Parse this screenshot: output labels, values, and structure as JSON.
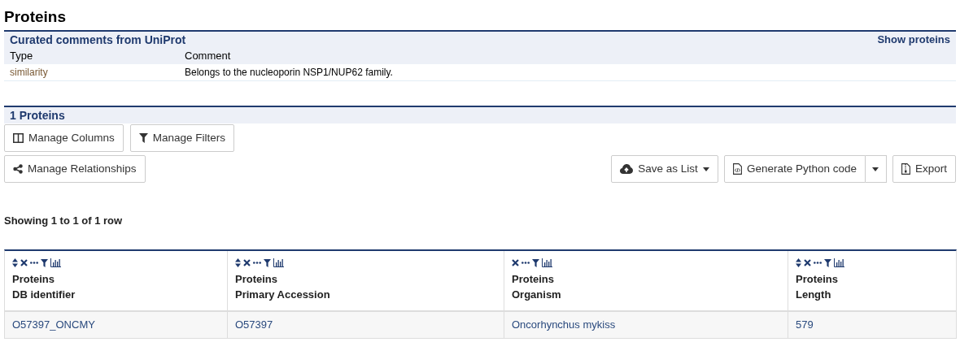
{
  "title": "Proteins",
  "comments": {
    "heading": "Curated comments from UniProt",
    "link": "Show proteins",
    "columns": [
      "Type",
      "Comment"
    ],
    "rows": [
      {
        "type": "similarity",
        "comment": "Belongs to the nucleoporin NSP1/NUP62 family."
      }
    ]
  },
  "results": {
    "heading": "1 Proteins",
    "left_buttons": [
      [
        {
          "kind": "columns",
          "label": "Manage Columns"
        },
        {
          "kind": "filter",
          "label": "Manage Filters"
        }
      ],
      [
        {
          "kind": "share",
          "label": "Manage Relationships"
        }
      ]
    ],
    "right_buttons": [
      {
        "kind": "cloud",
        "label": "Save as List",
        "caret": true,
        "split": false
      },
      {
        "kind": "code",
        "label": "Generate Python code",
        "caret": false,
        "split": true
      },
      {
        "kind": "export",
        "label": "Export",
        "caret": false,
        "split": false
      }
    ],
    "showing": "Showing 1 to 1 of 1 row",
    "table": {
      "columns": [
        {
          "lines": [
            "Proteins",
            "DB identifier"
          ],
          "sortable": true
        },
        {
          "lines": [
            "Proteins",
            "Primary Accession"
          ],
          "sortable": true
        },
        {
          "lines": [
            "Proteins",
            "Organism"
          ],
          "sortable": false
        },
        {
          "lines": [
            "Proteins",
            "Length"
          ],
          "sortable": true
        }
      ],
      "rows": [
        [
          "O57397_ONCMY",
          "O57397",
          "Oncorhynchus mykiss",
          "579"
        ]
      ]
    }
  }
}
